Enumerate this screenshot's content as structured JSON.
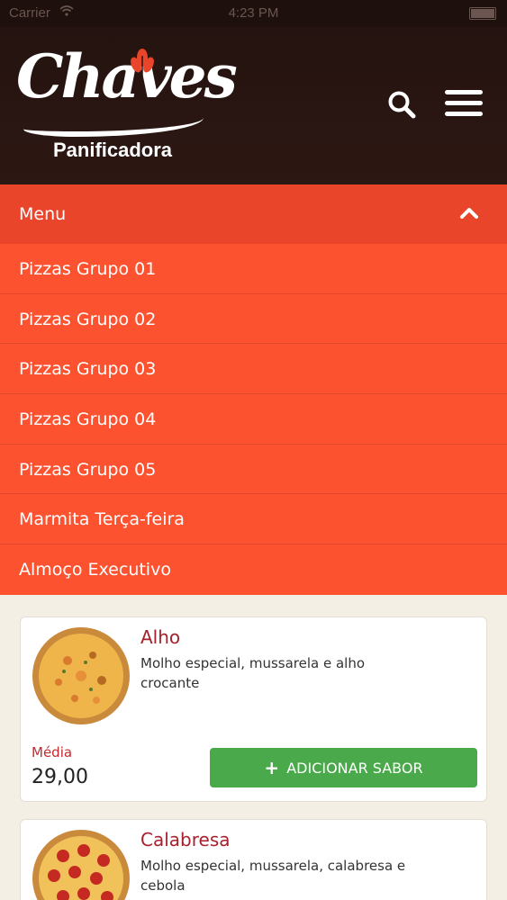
{
  "status_bar": {
    "carrier": "Carrier",
    "wifi_icon": "wifi-icon",
    "time": "4:23 PM",
    "battery_icon": "battery-icon"
  },
  "header": {
    "brand_name": "Chaves",
    "brand_subtitle": "Panificadora",
    "search_icon": "search-icon",
    "menu_icon": "hamburger-icon",
    "colors": {
      "background": "#2a1612"
    }
  },
  "menu": {
    "label": "Menu",
    "toggle_icon": "chevron-up-icon",
    "items": [
      {
        "label": "Pizzas Grupo 01"
      },
      {
        "label": "Pizzas Grupo 02"
      },
      {
        "label": "Pizzas Grupo 03"
      },
      {
        "label": "Pizzas Grupo 04"
      },
      {
        "label": "Pizzas Grupo 05"
      },
      {
        "label": "Marmita Terça-feira"
      },
      {
        "label": "Almoço Executivo"
      }
    ],
    "colors": {
      "header": "#e8452a",
      "items": "#fd5230"
    }
  },
  "products": [
    {
      "name": "Alho",
      "description": "Molho especial, mussarela e alho crocante",
      "size_label": "Média",
      "price": "29,00",
      "add_label": "ADICIONAR SABOR",
      "image_icon": "pizza-alho-image"
    },
    {
      "name": "Calabresa",
      "description": "Molho especial, mussarela, calabresa e cebola",
      "image_icon": "pizza-calabresa-image"
    }
  ],
  "colors": {
    "accent_green": "#4aa94a",
    "title_red": "#a5222d",
    "page_bg": "#f3efe4"
  }
}
